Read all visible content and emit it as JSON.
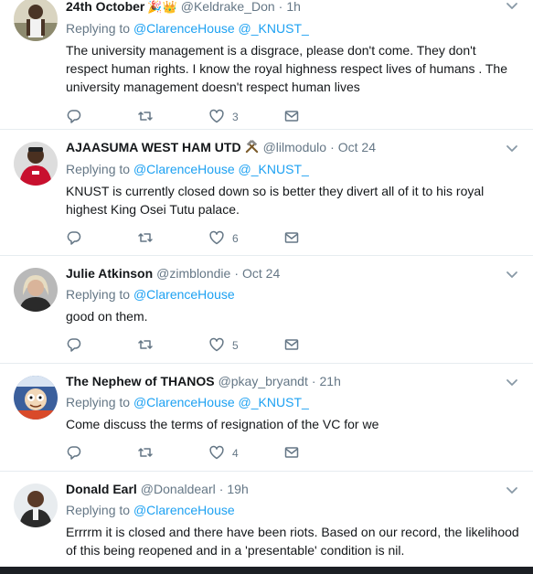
{
  "tweets": [
    {
      "name": "24th October",
      "emoji": "🎉👑",
      "handle": "@Keldrake_Don",
      "time": "1h",
      "replying_prefix": "Replying to",
      "mentions": [
        "@ClarenceHouse",
        "@_KNUST_"
      ],
      "text": "The university management is a disgrace, please don't come. They don't respect human rights. I know the royal highness respect lives of humans . The university management doesn't respect human lives",
      "likes": "3",
      "avatar_color": "#8d8a6e"
    },
    {
      "name": "AJAASUMA WEST HAM UTD",
      "emoji": "⚒",
      "handle": "@lilmodulo",
      "time": "Oct 24",
      "replying_prefix": "Replying to",
      "mentions": [
        "@ClarenceHouse",
        "@_KNUST_"
      ],
      "text": "KNUST is currently closed down so is better they divert all of it to his royal highest King Osei Tutu palace.",
      "likes": "6",
      "avatar_color": "#c8102e"
    },
    {
      "name": "Julie Atkinson",
      "emoji": "",
      "handle": "@zimblondie",
      "time": "Oct 24",
      "replying_prefix": "Replying to",
      "mentions": [
        "@ClarenceHouse"
      ],
      "text": "good on them.",
      "likes": "5",
      "avatar_color": "#9a9a9a"
    },
    {
      "name": "The Nephew of THANOS",
      "emoji": "",
      "handle": "@pkay_bryandt",
      "time": "21h",
      "replying_prefix": "Replying to",
      "mentions": [
        "@ClarenceHouse",
        "@_KNUST_"
      ],
      "text": "Come discuss the terms of resignation of the VC for we",
      "likes": "4",
      "avatar_color": "#5b7aa8"
    },
    {
      "name": "Donald Earl",
      "emoji": "",
      "handle": "@Donaldearl",
      "time": "19h",
      "replying_prefix": "Replying to",
      "mentions": [
        "@ClarenceHouse"
      ],
      "text": "Errrrm it is closed and there have been riots. Based on our record, the likelihood of this being reopened and in a 'presentable' condition is nil.",
      "likes": "",
      "avatar_color": "#3a3a3a"
    }
  ],
  "colors": {
    "link": "#1da1f2",
    "muted": "#657786",
    "text": "#14171a",
    "divider": "#e6ecf0"
  },
  "icons": [
    "reply-icon",
    "retweet-icon",
    "like-icon",
    "dm-icon",
    "caret-down-icon"
  ]
}
